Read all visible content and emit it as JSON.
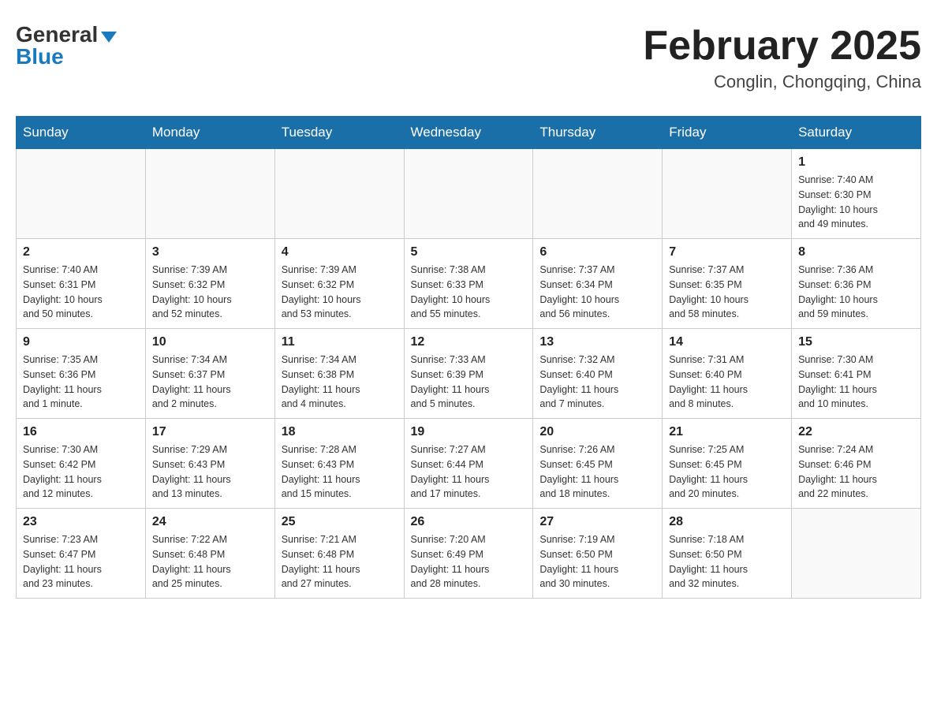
{
  "header": {
    "logo_general": "General",
    "logo_blue": "Blue",
    "month_title": "February 2025",
    "location": "Conglin, Chongqing, China"
  },
  "weekdays": [
    "Sunday",
    "Monday",
    "Tuesday",
    "Wednesday",
    "Thursday",
    "Friday",
    "Saturday"
  ],
  "weeks": [
    [
      {
        "day": "",
        "info": ""
      },
      {
        "day": "",
        "info": ""
      },
      {
        "day": "",
        "info": ""
      },
      {
        "day": "",
        "info": ""
      },
      {
        "day": "",
        "info": ""
      },
      {
        "day": "",
        "info": ""
      },
      {
        "day": "1",
        "info": "Sunrise: 7:40 AM\nSunset: 6:30 PM\nDaylight: 10 hours\nand 49 minutes."
      }
    ],
    [
      {
        "day": "2",
        "info": "Sunrise: 7:40 AM\nSunset: 6:31 PM\nDaylight: 10 hours\nand 50 minutes."
      },
      {
        "day": "3",
        "info": "Sunrise: 7:39 AM\nSunset: 6:32 PM\nDaylight: 10 hours\nand 52 minutes."
      },
      {
        "day": "4",
        "info": "Sunrise: 7:39 AM\nSunset: 6:32 PM\nDaylight: 10 hours\nand 53 minutes."
      },
      {
        "day": "5",
        "info": "Sunrise: 7:38 AM\nSunset: 6:33 PM\nDaylight: 10 hours\nand 55 minutes."
      },
      {
        "day": "6",
        "info": "Sunrise: 7:37 AM\nSunset: 6:34 PM\nDaylight: 10 hours\nand 56 minutes."
      },
      {
        "day": "7",
        "info": "Sunrise: 7:37 AM\nSunset: 6:35 PM\nDaylight: 10 hours\nand 58 minutes."
      },
      {
        "day": "8",
        "info": "Sunrise: 7:36 AM\nSunset: 6:36 PM\nDaylight: 10 hours\nand 59 minutes."
      }
    ],
    [
      {
        "day": "9",
        "info": "Sunrise: 7:35 AM\nSunset: 6:36 PM\nDaylight: 11 hours\nand 1 minute."
      },
      {
        "day": "10",
        "info": "Sunrise: 7:34 AM\nSunset: 6:37 PM\nDaylight: 11 hours\nand 2 minutes."
      },
      {
        "day": "11",
        "info": "Sunrise: 7:34 AM\nSunset: 6:38 PM\nDaylight: 11 hours\nand 4 minutes."
      },
      {
        "day": "12",
        "info": "Sunrise: 7:33 AM\nSunset: 6:39 PM\nDaylight: 11 hours\nand 5 minutes."
      },
      {
        "day": "13",
        "info": "Sunrise: 7:32 AM\nSunset: 6:40 PM\nDaylight: 11 hours\nand 7 minutes."
      },
      {
        "day": "14",
        "info": "Sunrise: 7:31 AM\nSunset: 6:40 PM\nDaylight: 11 hours\nand 8 minutes."
      },
      {
        "day": "15",
        "info": "Sunrise: 7:30 AM\nSunset: 6:41 PM\nDaylight: 11 hours\nand 10 minutes."
      }
    ],
    [
      {
        "day": "16",
        "info": "Sunrise: 7:30 AM\nSunset: 6:42 PM\nDaylight: 11 hours\nand 12 minutes."
      },
      {
        "day": "17",
        "info": "Sunrise: 7:29 AM\nSunset: 6:43 PM\nDaylight: 11 hours\nand 13 minutes."
      },
      {
        "day": "18",
        "info": "Sunrise: 7:28 AM\nSunset: 6:43 PM\nDaylight: 11 hours\nand 15 minutes."
      },
      {
        "day": "19",
        "info": "Sunrise: 7:27 AM\nSunset: 6:44 PM\nDaylight: 11 hours\nand 17 minutes."
      },
      {
        "day": "20",
        "info": "Sunrise: 7:26 AM\nSunset: 6:45 PM\nDaylight: 11 hours\nand 18 minutes."
      },
      {
        "day": "21",
        "info": "Sunrise: 7:25 AM\nSunset: 6:45 PM\nDaylight: 11 hours\nand 20 minutes."
      },
      {
        "day": "22",
        "info": "Sunrise: 7:24 AM\nSunset: 6:46 PM\nDaylight: 11 hours\nand 22 minutes."
      }
    ],
    [
      {
        "day": "23",
        "info": "Sunrise: 7:23 AM\nSunset: 6:47 PM\nDaylight: 11 hours\nand 23 minutes."
      },
      {
        "day": "24",
        "info": "Sunrise: 7:22 AM\nSunset: 6:48 PM\nDaylight: 11 hours\nand 25 minutes."
      },
      {
        "day": "25",
        "info": "Sunrise: 7:21 AM\nSunset: 6:48 PM\nDaylight: 11 hours\nand 27 minutes."
      },
      {
        "day": "26",
        "info": "Sunrise: 7:20 AM\nSunset: 6:49 PM\nDaylight: 11 hours\nand 28 minutes."
      },
      {
        "day": "27",
        "info": "Sunrise: 7:19 AM\nSunset: 6:50 PM\nDaylight: 11 hours\nand 30 minutes."
      },
      {
        "day": "28",
        "info": "Sunrise: 7:18 AM\nSunset: 6:50 PM\nDaylight: 11 hours\nand 32 minutes."
      },
      {
        "day": "",
        "info": ""
      }
    ]
  ]
}
